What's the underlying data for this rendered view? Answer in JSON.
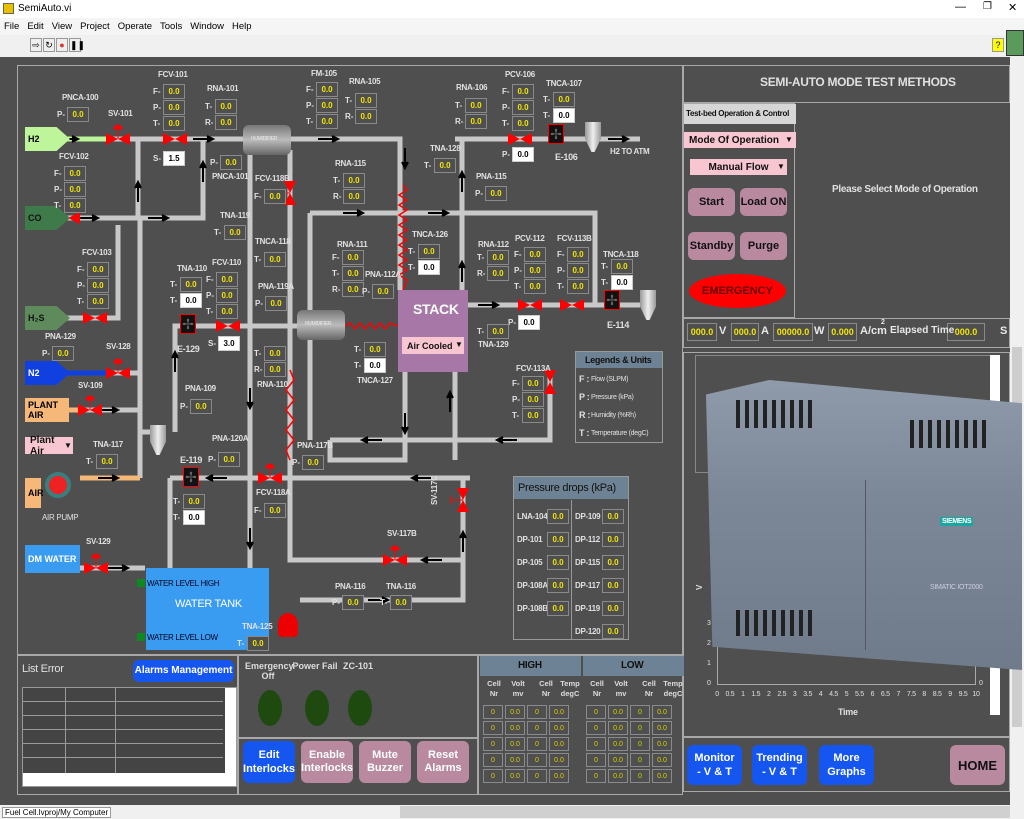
{
  "window": {
    "title": "SemiAuto.vi",
    "status_path": "Fuel Cell.lvproj/My Computer"
  },
  "menu": [
    "File",
    "Edit",
    "View",
    "Project",
    "Operate",
    "Tools",
    "Window",
    "Help"
  ],
  "sources": [
    {
      "label": "H2",
      "color": "#bff59a"
    },
    {
      "label": "CO",
      "color": "#3e7a4a"
    },
    {
      "label": "H₂S",
      "color": "#5f8b5c"
    },
    {
      "label": "N2",
      "color": "#1040e0"
    },
    {
      "label": "PLANT AIR",
      "color": "#f5b879"
    },
    {
      "label": "AIR",
      "color": "#f5b879"
    },
    {
      "label": "DM WATER",
      "color": "#3a9cf0"
    }
  ],
  "plant_air_select": "Plant Air",
  "air_pump_label": "AIR PUMP",
  "h2_outlet": "H2  TO ATM",
  "humidifier_label": "HUMIDIFIER",
  "valves": [
    "SV-101",
    "SV-128",
    "SV-109",
    "SV-129",
    "SV-117B",
    "SV-117C"
  ],
  "fans": [
    "E-106",
    "E-114",
    "E-129",
    "E-119"
  ],
  "stack": {
    "label": "STACK",
    "cooling": "Air Cooled"
  },
  "water_tank": {
    "label": "WATER  TANK",
    "level_high": "WATER LEVEL HIGH",
    "level_low": "WATER LEVEL LOW"
  },
  "instruments": [
    {
      "tag": "PNCA-100",
      "rows": [
        [
          "P-",
          "0.0"
        ]
      ]
    },
    {
      "tag": "FCV-101",
      "rows": [
        [
          "F-",
          "0.0"
        ],
        [
          "P-",
          "0.0"
        ],
        [
          "T-",
          "0.0"
        ]
      ]
    },
    {
      "tag": "",
      "rows": [
        [
          "S-",
          "1.5",
          "w"
        ]
      ]
    },
    {
      "tag": "RNA-101",
      "rows": [
        [
          "T-",
          "0.0"
        ],
        [
          "R-",
          "0.0"
        ]
      ]
    },
    {
      "tag": "PNCA-101",
      "rows": [
        [
          "P-",
          "0.0"
        ]
      ]
    },
    {
      "tag": "FM-105",
      "rows": [
        [
          "F-",
          "0.0"
        ],
        [
          "P-",
          "0.0"
        ],
        [
          "T-",
          "0.0"
        ]
      ]
    },
    {
      "tag": "RNA-105",
      "rows": [
        [
          "T-",
          "0.0"
        ],
        [
          "R-",
          "0.0"
        ]
      ]
    },
    {
      "tag": "RNA-106",
      "rows": [
        [
          "T-",
          "0.0"
        ],
        [
          "R-",
          "0.0"
        ]
      ]
    },
    {
      "tag": "PCV-106",
      "rows": [
        [
          "F-",
          "0.0"
        ],
        [
          "P-",
          "0.0"
        ],
        [
          "T-",
          "0.0"
        ]
      ]
    },
    {
      "tag": "",
      "rows": [
        [
          "P-",
          "0.0",
          "w"
        ]
      ]
    },
    {
      "tag": "TNCA-107",
      "rows": [
        [
          "T-",
          "0.0"
        ],
        [
          "T-",
          "0.0",
          "w"
        ]
      ]
    },
    {
      "tag": "TNA-128",
      "rows": [
        [
          "T-",
          "0.0"
        ]
      ]
    },
    {
      "tag": "PNA-115",
      "rows": [
        [
          "P-",
          "0.0"
        ]
      ]
    },
    {
      "tag": "RNA-115",
      "rows": [
        [
          "T-",
          "0.0"
        ],
        [
          "R-",
          "0.0"
        ]
      ]
    },
    {
      "tag": "FCV-102",
      "rows": [
        [
          "F-",
          "0.0"
        ],
        [
          "P-",
          "0.0"
        ],
        [
          "T-",
          "0.0"
        ]
      ]
    },
    {
      "tag": "FCV-118B",
      "rows": [
        [
          "F-",
          "0.0"
        ]
      ]
    },
    {
      "tag": "TNA-119",
      "rows": [
        [
          "T-",
          "0.0"
        ]
      ]
    },
    {
      "tag": "TNCA-118",
      "rows": [
        [
          "T-",
          "0.0"
        ]
      ]
    },
    {
      "tag": "TNCA-126",
      "rows": [
        [
          "T-",
          "0.0"
        ],
        [
          "T-",
          "0.0",
          "w"
        ]
      ]
    },
    {
      "tag": "RNA-111",
      "rows": [
        [
          "F-",
          "0.0"
        ],
        [
          "T-",
          "0.0"
        ],
        [
          "R-",
          "0.0"
        ]
      ]
    },
    {
      "tag": "PNA-112A",
      "rows": [
        [
          "P-",
          "0.0"
        ]
      ]
    },
    {
      "tag": "RNA-112",
      "rows": [
        [
          "T-",
          "0.0"
        ],
        [
          "R-",
          "0.0"
        ]
      ]
    },
    {
      "tag": "PCV-112",
      "rows": [
        [
          "F-",
          "0.0"
        ],
        [
          "P-",
          "0.0"
        ],
        [
          "T-",
          "0.0"
        ]
      ]
    },
    {
      "tag": "",
      "rows": [
        [
          "P-",
          "0.0",
          "w"
        ]
      ]
    },
    {
      "tag": "FCV-113B",
      "rows": [
        [
          "F-",
          "0.0"
        ],
        [
          "P-",
          "0.0"
        ],
        [
          "T-",
          "0.0"
        ]
      ]
    },
    {
      "tag": "TNCA-118",
      "rows": [
        [
          "T-",
          "0.0"
        ],
        [
          "T-",
          "0.0",
          "w"
        ]
      ]
    },
    {
      "tag": "TNA-129",
      "rows": [
        [
          "T-",
          "0.0"
        ]
      ]
    },
    {
      "tag": "FCV-103",
      "rows": [
        [
          "F-",
          "0.0"
        ],
        [
          "P-",
          "0.0"
        ],
        [
          "T-",
          "0.0"
        ]
      ]
    },
    {
      "tag": "TNA-110",
      "rows": [
        [
          "T-",
          "0.0"
        ],
        [
          "T-",
          "0.0",
          "w"
        ]
      ]
    },
    {
      "tag": "FCV-110",
      "rows": [
        [
          "F-",
          "0.0"
        ],
        [
          "P-",
          "0.0"
        ],
        [
          "T-",
          "0.0"
        ]
      ]
    },
    {
      "tag": "",
      "rows": [
        [
          "S-",
          "3.0",
          "w"
        ]
      ]
    },
    {
      "tag": "PNA-119A",
      "rows": [
        [
          "P-",
          "0.0"
        ]
      ]
    },
    {
      "tag": "RNA-110",
      "rows": [
        [
          "T-",
          "0.0"
        ],
        [
          "R-",
          "0.0"
        ]
      ]
    },
    {
      "tag": "TNCA-127",
      "rows": [
        [
          "T-",
          "0.0"
        ],
        [
          "T-",
          "0.0",
          "w"
        ]
      ]
    },
    {
      "tag": "PNA-129",
      "rows": [
        [
          "P-",
          "0.0"
        ]
      ]
    },
    {
      "tag": "PNA-109",
      "rows": [
        [
          "P-",
          "0.0"
        ]
      ]
    },
    {
      "tag": "TNA-117",
      "rows": [
        [
          "T-",
          "0.0"
        ]
      ]
    },
    {
      "tag": "PNA-120A",
      "rows": [
        [
          "P-",
          "0.0"
        ]
      ]
    },
    {
      "tag": "",
      "rows": [
        [
          "T-",
          "0.0"
        ],
        [
          "T-",
          "0.0",
          "w"
        ]
      ]
    },
    {
      "tag": "FCV-118A",
      "rows": [
        [
          "F-",
          "0.0"
        ]
      ]
    },
    {
      "tag": "PNA-117B",
      "rows": [
        [
          "P-",
          "0.0"
        ]
      ]
    },
    {
      "tag": "FCV-113A",
      "rows": [
        [
          "F-",
          "0.0"
        ],
        [
          "P-",
          "0.0"
        ],
        [
          "T-",
          "0.0"
        ]
      ]
    },
    {
      "tag": "PNA-116",
      "rows": [
        [
          "P-",
          "0.0"
        ]
      ]
    },
    {
      "tag": "TNA-116",
      "rows": [
        [
          "T-",
          "0.0"
        ]
      ]
    },
    {
      "tag": "TNA-125",
      "rows": [
        [
          "T-",
          "0.0"
        ]
      ]
    }
  ],
  "legend": {
    "title": "Legends & Units",
    "items": [
      [
        "F :",
        "Flow (SLPM)"
      ],
      [
        "P :",
        "Pressure (kPa)"
      ],
      [
        "R :",
        "Humidity (%Rh)"
      ],
      [
        "T :",
        "Temperature (degC)"
      ]
    ]
  },
  "pressure_drops": {
    "title": "Pressure drops (kPa)",
    "left": [
      [
        "LNA-104",
        "0.0"
      ],
      [
        "DP-101",
        "0.0"
      ],
      [
        "DP-105",
        "0.0"
      ],
      [
        "DP-108A",
        "0.0"
      ],
      [
        "DP-108B",
        "0.0"
      ]
    ],
    "right": [
      [
        "DP-109",
        "0.0"
      ],
      [
        "DP-112",
        "0.0"
      ],
      [
        "DP-115",
        "0.0"
      ],
      [
        "DP-117",
        "0.0"
      ],
      [
        "DP-119",
        "0.0"
      ],
      [
        "DP-120",
        "0.0"
      ]
    ]
  },
  "right_panel": {
    "title": "SEMI-AUTO MODE TEST METHODS",
    "control_header": "Test-bed Operation & Control",
    "mode_select": "Mode Of Operation",
    "flow_select": "Manual Flow",
    "buttons": {
      "start": "Start",
      "load_on": "Load ON",
      "standby": "Standby",
      "purge": "Purge",
      "emergency": "EMERGENCY"
    },
    "message": "Please Select Mode of Operation",
    "readouts": {
      "voltage": "000.0",
      "voltage_unit": "V",
      "current": "000.0",
      "current_unit": "A",
      "power": "00000.0",
      "power_unit": "W",
      "density": "0.000",
      "density_unit": "A/cm",
      "density_exp": "2",
      "elapsed_label": "Elapsed Time",
      "elapsed": "000.0",
      "elapsed_unit": "S"
    }
  },
  "chart_data": {
    "type": "line",
    "xlabel": "Time",
    "ylabel": "V",
    "xlim": [
      0,
      10
    ],
    "ylim": [
      0,
      3
    ],
    "xticks": [
      "0",
      "0.5",
      "1",
      "1.5",
      "2",
      "2.5",
      "3",
      "3.5",
      "4",
      "4.5",
      "5",
      "5.5",
      "6",
      "6.5",
      "7",
      "7.5",
      "8",
      "8.5",
      "9",
      "9.5",
      "10"
    ],
    "yticks": [
      "0",
      "1",
      "2",
      "3"
    ],
    "right_tick": "0",
    "series": []
  },
  "device_image": {
    "brand": "SIEMENS",
    "model": "SIMATIC IOT2000"
  },
  "nav_buttons": {
    "monitor": "Monitor - V & T",
    "trending": "Trending - V & T",
    "more": "More Graphs",
    "home": "HOME"
  },
  "bottom": {
    "list_error": "List Error",
    "alarms_management": "Alarms Management",
    "indicators": [
      {
        "label": "Emergency Off",
        "color": "#1e4a10"
      },
      {
        "label": "Power Fail",
        "color": "#1e4a10"
      },
      {
        "label": "ZC-101",
        "color": "#1e4a10"
      }
    ],
    "buttons": [
      {
        "label": "Edit Interlocks",
        "style": "blue"
      },
      {
        "label": "Enable Interlocks",
        "style": "pink"
      },
      {
        "label": "Mute Buzzer",
        "style": "pink"
      },
      {
        "label": "Reset Alarms",
        "style": "pink"
      }
    ],
    "high": {
      "title": "HIGH",
      "cols": [
        "Cell Nr",
        "Volt mv",
        "Cell Nr",
        "Temp degC"
      ],
      "rows": [
        [
          "0",
          "0.0",
          "0",
          "0.0"
        ],
        [
          "0",
          "0.0",
          "0",
          "0.0"
        ],
        [
          "0",
          "0.0",
          "0",
          "0.0"
        ],
        [
          "0",
          "0.0",
          "0",
          "0.0"
        ],
        [
          "0",
          "0.0",
          "0",
          "0.0"
        ]
      ]
    },
    "low": {
      "title": "LOW",
      "cols": [
        "Cell Nr",
        "Volt mv",
        "Cell Nr",
        "Temp degC"
      ],
      "rows": [
        [
          "0",
          "0.0",
          "0",
          "0.0"
        ],
        [
          "0",
          "0.0",
          "0",
          "0.0"
        ],
        [
          "0",
          "0.0",
          "0",
          "0.0"
        ],
        [
          "0",
          "0.0",
          "0",
          "0.0"
        ],
        [
          "0",
          "0.0",
          "0",
          "0.0"
        ]
      ]
    }
  }
}
